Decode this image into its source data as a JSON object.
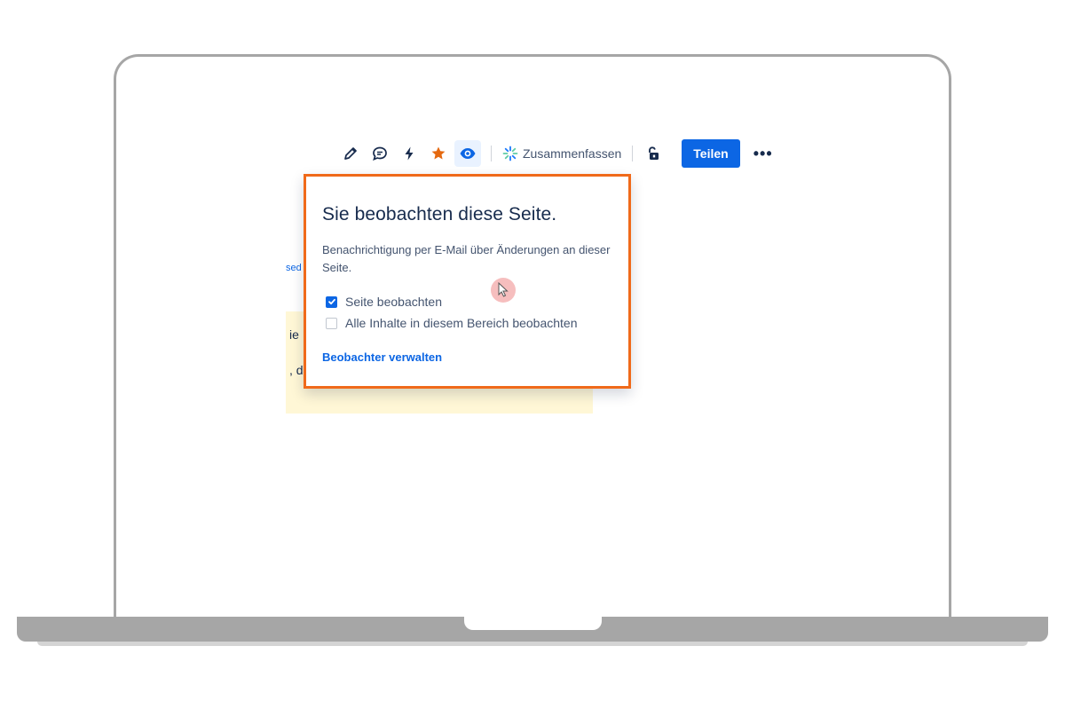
{
  "toolbar": {
    "summarize_label": "Zusammenfassen",
    "share_label": "Teilen",
    "more_label": "•••",
    "icons": [
      "pencil-icon",
      "comment-icon",
      "lightning-icon",
      "star-icon",
      "eye-icon",
      "sparkle-icon",
      "unlock-icon"
    ]
  },
  "background": {
    "link_fragment": "sed",
    "note_line_1": "ie",
    "note_line_2": ", d"
  },
  "popup": {
    "title": "Sie beobachten diese Seite.",
    "description": "Benachrichtigung per E-Mail über Änderungen an dieser Seite.",
    "options": [
      {
        "label": "Seite beobachten",
        "checked": true
      },
      {
        "label": "Alle Inhalte in diesem Bereich beobachten",
        "checked": false
      }
    ],
    "manage_link": "Beobachter verwalten"
  },
  "colors": {
    "accent_blue": "#0c66e4",
    "highlight_border": "#f06a1a",
    "star": "#e56910",
    "note_bg": "#fff7d6"
  }
}
